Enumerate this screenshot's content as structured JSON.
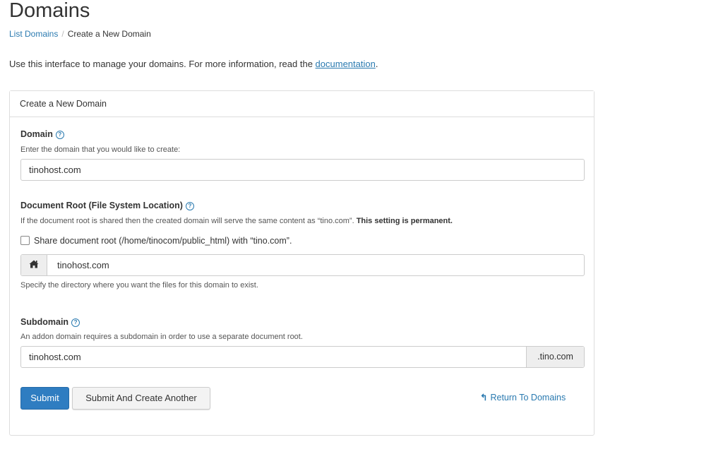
{
  "page": {
    "title": "Domains",
    "breadcrumb": {
      "link": "List Domains",
      "separator": "/",
      "current": "Create a New Domain"
    },
    "intro_text": "Use this interface to manage your domains. For more information, read the ",
    "intro_link": "documentation",
    "intro_end": "."
  },
  "panel": {
    "heading": "Create a New Domain",
    "domain": {
      "label": "Domain",
      "hint": "Enter the domain that you would like to create:",
      "value": "tinohost.com"
    },
    "docroot": {
      "label": "Document Root (File System Location)",
      "hint": "If the document root is shared then the created domain will serve the same content as “tino.com”. ",
      "hint_bold": "This setting is permanent.",
      "share_label": "Share document root (/home/tinocom/public_html) with “tino.com”.",
      "share_checked": false,
      "home_icon": "home-icon",
      "value": "tinohost.com",
      "help": "Specify the directory where you want the files for this domain to exist."
    },
    "subdomain": {
      "label": "Subdomain",
      "hint": "An addon domain requires a subdomain in order to use a separate document root.",
      "value": "tinohost.com",
      "suffix": ".tino.com"
    },
    "buttons": {
      "submit": "Submit",
      "submit_another": "Submit And Create Another",
      "return": "Return To Domains"
    }
  },
  "colors": {
    "accent": "#2f7dc1",
    "link": "#2a7ab0"
  }
}
